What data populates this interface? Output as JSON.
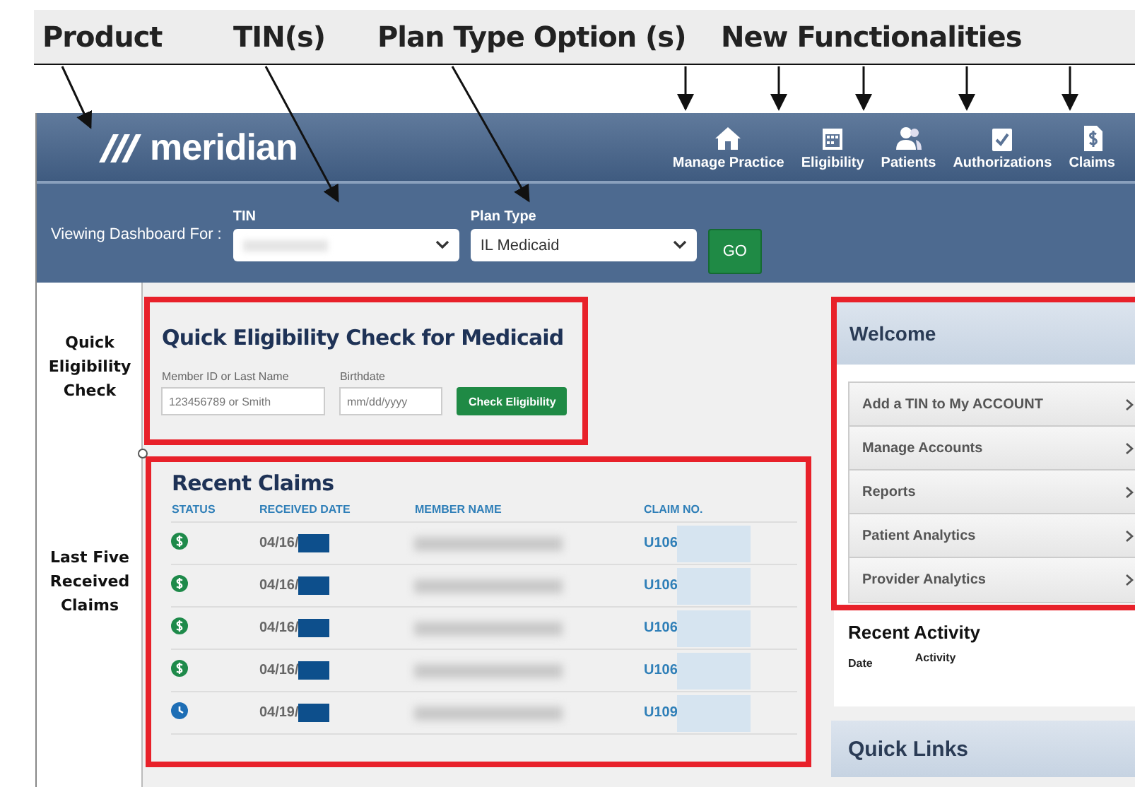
{
  "annotations": {
    "labels": [
      "Product",
      "TIN(s)",
      "Plan Type Option (s)",
      "New Functionalities"
    ],
    "side_labels": [
      "Quick Eligibility Check",
      "Last Five Received Claims"
    ]
  },
  "header": {
    "logo": "meridian",
    "nav": [
      {
        "kind": "house",
        "label": "Manage Practice"
      },
      {
        "kind": "calendar",
        "label": "Eligibility"
      },
      {
        "kind": "people",
        "label": "Patients"
      },
      {
        "kind": "clipboard",
        "label": "Authorizations"
      },
      {
        "kind": "dollar",
        "label": "Claims"
      }
    ]
  },
  "filter_bar": {
    "label": "Viewing Dashboard For :",
    "tin": {
      "label": "TIN"
    },
    "plan_type": {
      "label": "Plan Type",
      "value": "IL Medicaid"
    },
    "go_button": "GO"
  },
  "quick_check": {
    "title": "Quick Eligibility Check for Medicaid",
    "fields": [
      {
        "label": "Member ID or Last Name",
        "placeholder": "123456789 or Smith"
      },
      {
        "label": "Birthdate",
        "placeholder": "mm/dd/yyyy"
      }
    ],
    "button": "Check Eligibility"
  },
  "recent_claims": {
    "title": "Recent Claims",
    "columns": [
      "STATUS",
      "RECEIVED DATE",
      "MEMBER NAME",
      "CLAIM NO."
    ],
    "rows": [
      {
        "kind": "paid",
        "date": "04/16/",
        "claim_no": "U106"
      },
      {
        "kind": "paid",
        "date": "04/16/",
        "claim_no": "U106"
      },
      {
        "kind": "paid",
        "date": "04/16/",
        "claim_no": "U106"
      },
      {
        "kind": "paid",
        "date": "04/16/",
        "claim_no": "U106"
      },
      {
        "kind": "pending",
        "date": "04/19/",
        "claim_no": "U109"
      }
    ]
  },
  "welcome": {
    "title": "Welcome",
    "items": [
      "Add a TIN to My ACCOUNT",
      "Manage Accounts",
      "Reports",
      "Patient Analytics",
      "Provider Analytics"
    ]
  },
  "recent_activity": {
    "title": "Recent Activity",
    "columns": [
      "Date",
      "Activity"
    ]
  },
  "quick_links": {
    "title": "Quick Links"
  }
}
